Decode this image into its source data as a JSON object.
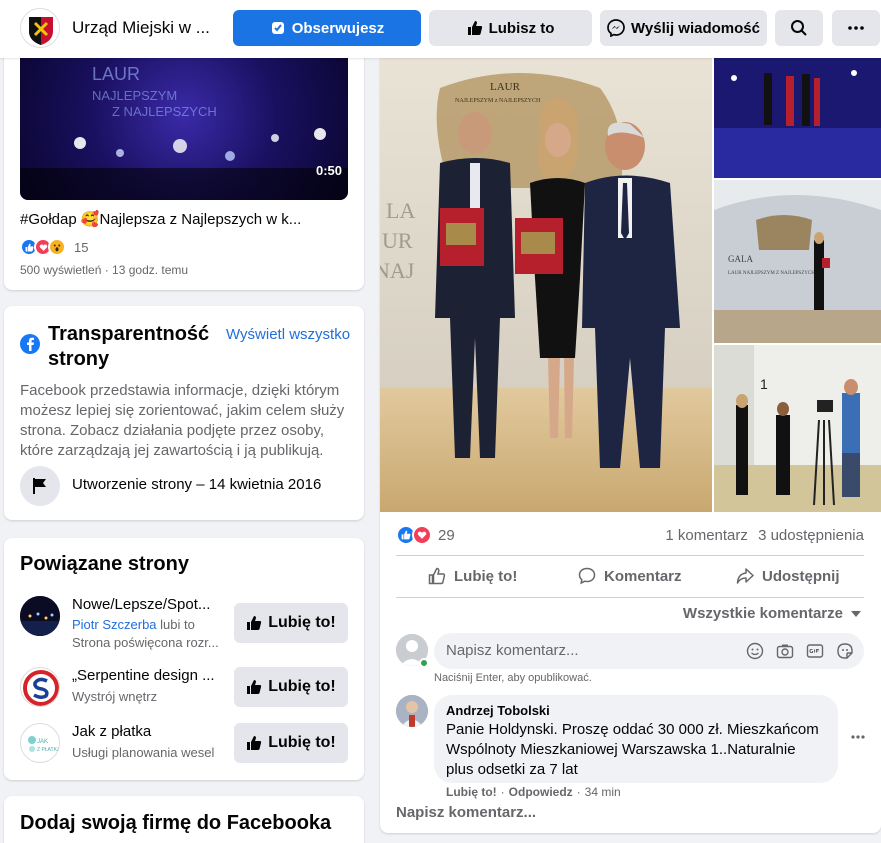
{
  "header": {
    "page_name": "Urząd Miejski w ...",
    "follow_label": "Obserwujesz",
    "like_label": "Lubisz to",
    "message_label": "Wyślij wiadomość"
  },
  "video": {
    "duration": "0:50",
    "caption": "#Gołdap 🥰Najlepsza z Najlepszych w k...",
    "reactions_count": "15",
    "meta": "500 wyświetleń · 13 godz. temu"
  },
  "transparency": {
    "title_line1": "Transparentność",
    "title_line2": "strony",
    "view_all": "Wyświetl wszystko",
    "description": "Facebook przedstawia informacje, dzięki którym możesz lepiej się zorientować, jakim celem służy strona. Zobacz działania podjęte przez osoby, które zarządzają jej zawartością i ją publikują.",
    "created": "Utworzenie strony – 14 kwietnia 2016"
  },
  "related": {
    "title": "Powiązane strony",
    "items": [
      {
        "name": "Nowe/Lepsze/Spot...",
        "sub1": "Piotr Szczerba",
        "sub1b": " lubi to",
        "sub2": "Strona poświęcona rozr...",
        "button": "Lubię to!"
      },
      {
        "name": "„Serpentine design ...",
        "sub1": "Wystrój wnętrz",
        "button": "Lubię to!"
      },
      {
        "name": "Jak z płatka",
        "sub1": "Usługi planowania wesel",
        "button": "Lubię to!",
        "logo_text": "JAK Z PŁATKA"
      }
    ]
  },
  "business": {
    "title": "Dodaj swoją firmę do Facebooka"
  },
  "post": {
    "reactions_count": "29",
    "comments": "1 komentarz",
    "shares": "3 udostępnienia",
    "like_action": "Lubię to!",
    "comment_action": "Komentarz",
    "share_action": "Udostępnij",
    "sort_label": "Wszystkie komentarze",
    "comment_placeholder": "Napisz komentarz...",
    "enter_hint": "Naciśnij Enter, aby opublikować.",
    "comment": {
      "author": "Andrzej Tobolski",
      "text": "Panie Holdynski. Proszę oddać 30 000 zł. Mieszkańcom Wspólnoty Mieszkaniowej Warszawska 1..Naturalnie plus odsetki za 7 lat",
      "like": "Lubię to!",
      "reply": "Odpowiedz",
      "time": "34 min"
    },
    "write_more": "Napisz komentarz...",
    "photo_texts": {
      "laur": "LAUR",
      "laur_sub": "NAJLEPSZYM z NAJLEPSZYCH",
      "gala": "GALA",
      "gala_sub": "LAUR NAJLEPSZYM Z NAJLEPSZYCH",
      "number": "1",
      "video_title": "LAUR NAJLEPSZYM Z NAJLEPSZYCH"
    }
  }
}
